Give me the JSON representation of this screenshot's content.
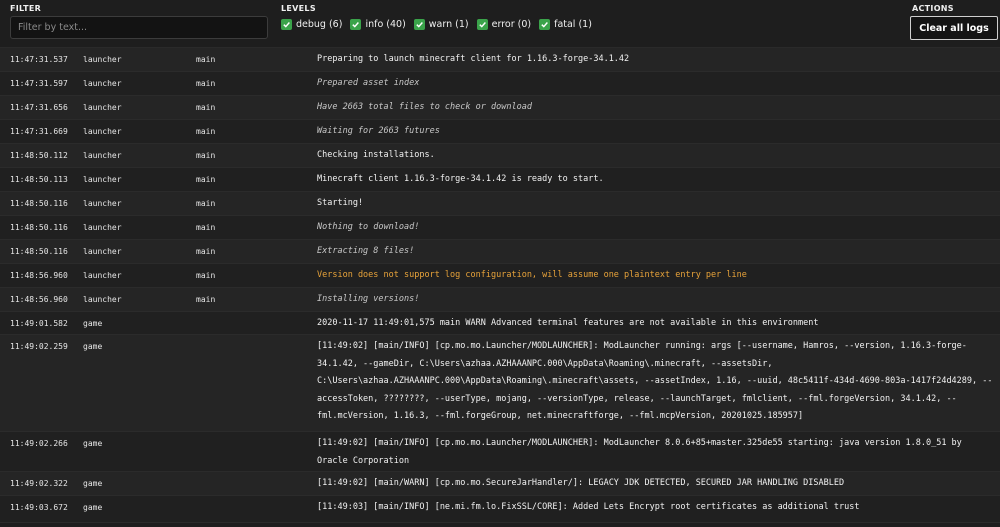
{
  "filter": {
    "label": "FILTER",
    "placeholder": "Filter by text..."
  },
  "levels": {
    "label": "LEVELS",
    "items": [
      {
        "label": "debug (6)",
        "checked": true
      },
      {
        "label": "info (40)",
        "checked": true
      },
      {
        "label": "warn (1)",
        "checked": true
      },
      {
        "label": "error (0)",
        "checked": true
      },
      {
        "label": "fatal (1)",
        "checked": true
      }
    ]
  },
  "actions": {
    "label": "ACTIONS",
    "clear_label": "Clear all logs"
  },
  "colors": {
    "checkbox": "#3aa34a",
    "warn": "#e8a33a",
    "background": "#1e1e1e"
  },
  "logs": [
    {
      "time": "11:47:31.537",
      "source": "launcher",
      "thread": "main",
      "level": "info",
      "message": "Preparing to launch minecraft client for 1.16.3-forge-34.1.42"
    },
    {
      "time": "11:47:31.597",
      "source": "launcher",
      "thread": "main",
      "level": "debug",
      "message": "Prepared asset index"
    },
    {
      "time": "11:47:31.656",
      "source": "launcher",
      "thread": "main",
      "level": "debug",
      "message": "Have 2663 total files to check or download"
    },
    {
      "time": "11:47:31.669",
      "source": "launcher",
      "thread": "main",
      "level": "debug",
      "message": "Waiting for 2663 futures"
    },
    {
      "time": "11:48:50.112",
      "source": "launcher",
      "thread": "main",
      "level": "info",
      "message": "Checking installations."
    },
    {
      "time": "11:48:50.113",
      "source": "launcher",
      "thread": "main",
      "level": "info",
      "message": "Minecraft client 1.16.3-forge-34.1.42 is ready to start."
    },
    {
      "time": "11:48:50.116",
      "source": "launcher",
      "thread": "main",
      "level": "info",
      "message": "Starting!"
    },
    {
      "time": "11:48:50.116",
      "source": "launcher",
      "thread": "main",
      "level": "debug",
      "message": "Nothing to download!"
    },
    {
      "time": "11:48:50.116",
      "source": "launcher",
      "thread": "main",
      "level": "debug",
      "message": "Extracting 8 files!"
    },
    {
      "time": "11:48:56.960",
      "source": "launcher",
      "thread": "main",
      "level": "warn",
      "message": "Version does not support log configuration, will assume one plaintext entry per line"
    },
    {
      "time": "11:48:56.960",
      "source": "launcher",
      "thread": "main",
      "level": "debug",
      "message": "Installing versions!"
    },
    {
      "time": "11:49:01.582",
      "source": "game",
      "thread": "",
      "level": "info",
      "message": "2020-11-17 11:49:01,575 main WARN Advanced terminal features are not available in this environment"
    },
    {
      "time": "11:49:02.259",
      "source": "game",
      "thread": "",
      "level": "info",
      "message": "[11:49:02] [main/INFO] [cp.mo.mo.Launcher/MODLAUNCHER]: ModLauncher running: args [--username, Hamros, --version, 1.16.3-forge-34.1.42, --gameDir, C:\\Users\\azhaa.AZHAAANPC.000\\AppData\\Roaming\\.minecraft, --assetsDir, C:\\Users\\azhaa.AZHAAANPC.000\\AppData\\Roaming\\.minecraft\\assets, --assetIndex, 1.16, --uuid, 48c5411f-434d-4690-803a-1417f24d4289, --accessToken, ????????, --userType, mojang, --versionType, release, --launchTarget, fmlclient, --fml.forgeVersion, 34.1.42, --fml.mcVersion, 1.16.3, --fml.forgeGroup, net.minecraftforge, --fml.mcpVersion, 20201025.185957]"
    },
    {
      "time": "11:49:02.266",
      "source": "game",
      "thread": "",
      "level": "info",
      "message": "[11:49:02] [main/INFO] [cp.mo.mo.Launcher/MODLAUNCHER]: ModLauncher 8.0.6+85+master.325de55 starting: java version 1.8.0_51 by Oracle Corporation"
    },
    {
      "time": "11:49:02.322",
      "source": "game",
      "thread": "",
      "level": "info",
      "message": "[11:49:02] [main/WARN] [cp.mo.mo.SecureJarHandler/]: LEGACY JDK DETECTED, SECURED JAR HANDLING DISABLED"
    },
    {
      "time": "11:49:03.672",
      "source": "game",
      "thread": "",
      "level": "info",
      "message": "[11:49:03] [main/INFO] [ne.mi.fm.lo.FixSSL/CORE]: Added Lets Encrypt root certificates as additional trust"
    }
  ]
}
